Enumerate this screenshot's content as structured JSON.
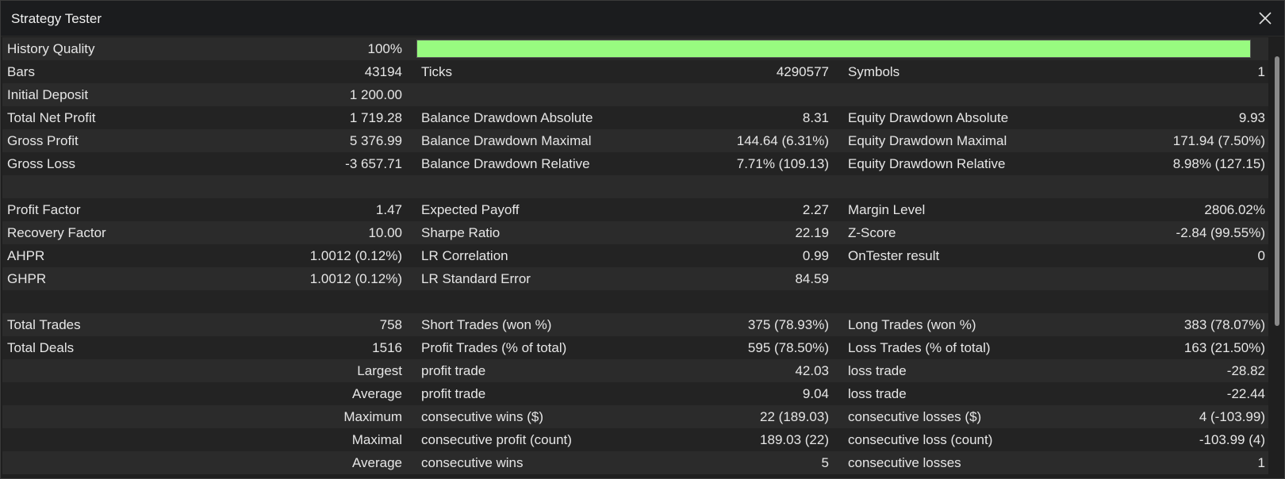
{
  "window": {
    "title": "Strategy Tester"
  },
  "history_quality": {
    "label": "History Quality",
    "value": "100%",
    "fraction": 1.0
  },
  "rows": [
    [
      {
        "l": "Bars",
        "v": "43194"
      },
      {
        "l": "Ticks",
        "v": "4290577"
      },
      {
        "l": "Symbols",
        "v": "1"
      }
    ],
    [
      {
        "l": "Initial Deposit",
        "v": "1 200.00"
      },
      {
        "l": "",
        "v": ""
      },
      {
        "l": "",
        "v": ""
      }
    ],
    [
      {
        "l": "Total Net Profit",
        "v": "1 719.28"
      },
      {
        "l": "Balance Drawdown Absolute",
        "v": "8.31"
      },
      {
        "l": "Equity Drawdown Absolute",
        "v": "9.93"
      }
    ],
    [
      {
        "l": "Gross Profit",
        "v": "5 376.99"
      },
      {
        "l": "Balance Drawdown Maximal",
        "v": "144.64 (6.31%)"
      },
      {
        "l": "Equity Drawdown Maximal",
        "v": "171.94 (7.50%)"
      }
    ],
    [
      {
        "l": "Gross Loss",
        "v": "-3 657.71"
      },
      {
        "l": "Balance Drawdown Relative",
        "v": "7.71% (109.13)"
      },
      {
        "l": "Equity Drawdown Relative",
        "v": "8.98% (127.15)"
      }
    ],
    [
      {
        "l": "",
        "v": ""
      },
      {
        "l": "",
        "v": ""
      },
      {
        "l": "",
        "v": ""
      }
    ],
    [
      {
        "l": "Profit Factor",
        "v": "1.47"
      },
      {
        "l": "Expected Payoff",
        "v": "2.27"
      },
      {
        "l": "Margin Level",
        "v": "2806.02%"
      }
    ],
    [
      {
        "l": "Recovery Factor",
        "v": "10.00"
      },
      {
        "l": "Sharpe Ratio",
        "v": "22.19"
      },
      {
        "l": "Z-Score",
        "v": "-2.84 (99.55%)"
      }
    ],
    [
      {
        "l": "AHPR",
        "v": "1.0012 (0.12%)"
      },
      {
        "l": "LR Correlation",
        "v": "0.99"
      },
      {
        "l": "OnTester result",
        "v": "0"
      }
    ],
    [
      {
        "l": "GHPR",
        "v": "1.0012 (0.12%)"
      },
      {
        "l": "LR Standard Error",
        "v": "84.59"
      },
      {
        "l": "",
        "v": ""
      }
    ],
    [
      {
        "l": "",
        "v": ""
      },
      {
        "l": "",
        "v": ""
      },
      {
        "l": "",
        "v": ""
      }
    ],
    [
      {
        "l": "Total Trades",
        "v": "758"
      },
      {
        "l": "Short Trades (won %)",
        "v": "375 (78.93%)"
      },
      {
        "l": "Long Trades (won %)",
        "v": "383 (78.07%)"
      }
    ],
    [
      {
        "l": "Total Deals",
        "v": "1516"
      },
      {
        "l": "Profit Trades (% of total)",
        "v": "595 (78.50%)"
      },
      {
        "l": "Loss Trades (% of total)",
        "v": "163 (21.50%)"
      }
    ],
    [
      {
        "l": "",
        "v": "Largest"
      },
      {
        "l": "profit trade",
        "v": "42.03"
      },
      {
        "l": "loss trade",
        "v": "-28.82"
      }
    ],
    [
      {
        "l": "",
        "v": "Average"
      },
      {
        "l": "profit trade",
        "v": "9.04"
      },
      {
        "l": "loss trade",
        "v": "-22.44"
      }
    ],
    [
      {
        "l": "",
        "v": "Maximum"
      },
      {
        "l": "consecutive wins ($)",
        "v": "22 (189.03)"
      },
      {
        "l": "consecutive losses ($)",
        "v": "4 (-103.99)"
      }
    ],
    [
      {
        "l": "",
        "v": "Maximal"
      },
      {
        "l": "consecutive profit (count)",
        "v": "189.03 (22)"
      },
      {
        "l": "consecutive loss (count)",
        "v": "-103.99 (4)"
      }
    ],
    [
      {
        "l": "",
        "v": "Average"
      },
      {
        "l": "consecutive wins",
        "v": "5"
      },
      {
        "l": "consecutive losses",
        "v": "1"
      }
    ]
  ],
  "colors": {
    "quality_fill": "#98fb80",
    "row_odd": "#2b2b2b",
    "row_even": "#232323"
  },
  "icons": {
    "close": "close-icon"
  }
}
